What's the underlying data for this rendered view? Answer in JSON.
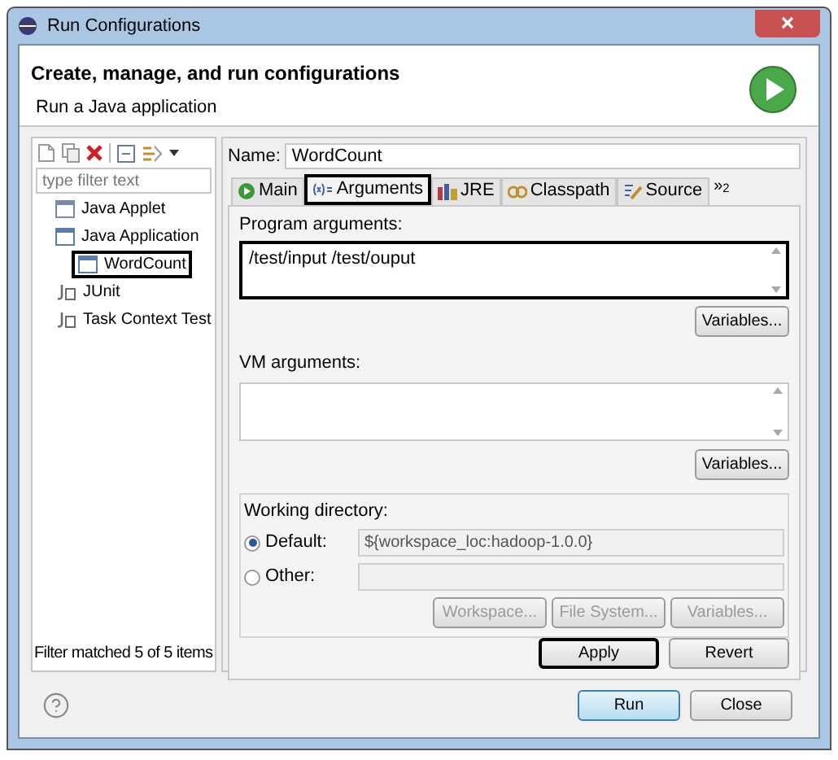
{
  "window": {
    "title": "Run Configurations"
  },
  "header": {
    "title": "Create, manage, and run configurations",
    "subtitle": "Run a Java application"
  },
  "filter": {
    "placeholder": "type filter text"
  },
  "tree": [
    {
      "label": "Java Applet",
      "kind": "applet",
      "highlighted": false
    },
    {
      "label": "Java Application",
      "kind": "app",
      "highlighted": false,
      "children": [
        {
          "label": "WordCount",
          "kind": "class",
          "highlighted": true
        }
      ]
    },
    {
      "label": "JUnit",
      "kind": "junit",
      "highlighted": false
    },
    {
      "label": "Task Context Test",
      "kind": "task",
      "highlighted": false
    }
  ],
  "filter_status": "Filter matched 5 of 5 items",
  "name": {
    "label": "Name:",
    "value": "WordCount"
  },
  "tabs": [
    {
      "label": "Main",
      "kind": "main",
      "selected": false,
      "highlighted": false
    },
    {
      "label": "Arguments",
      "kind": "args",
      "selected": true,
      "highlighted": true
    },
    {
      "label": "JRE",
      "kind": "jre",
      "selected": false,
      "highlighted": false
    },
    {
      "label": "Classpath",
      "kind": "classpath",
      "selected": false,
      "highlighted": false
    },
    {
      "label": "Source",
      "kind": "source",
      "selected": false,
      "highlighted": false
    }
  ],
  "tabs_overflow": "»$_{2}$",
  "program_arguments": {
    "label": "Program arguments:",
    "value": "/test/input /test/ouput",
    "highlighted": true,
    "button": "Variables..."
  },
  "vm_arguments": {
    "label": "VM arguments:",
    "highlighted": false,
    "button": "Variables..."
  },
  "working_directory": {
    "label": "Working directory:",
    "options": [
      {
        "label": "Default:",
        "selected": true,
        "value": "${workspace_loc:hadoop-1.0.0}"
      },
      {
        "label": "Other:",
        "selected": false
      }
    ],
    "buttons": [
      {
        "label": "Workspace...",
        "disabled": true
      },
      {
        "label": "File System...",
        "disabled": true
      },
      {
        "label": "Variables...",
        "disabled": true
      }
    ]
  },
  "config_buttons": [
    {
      "label": "Apply",
      "highlighted": true
    },
    {
      "label": "Revert",
      "highlighted": false
    }
  ],
  "dialog_buttons": [
    {
      "label": "Run",
      "default": true
    },
    {
      "label": "Close",
      "default": false
    }
  ]
}
